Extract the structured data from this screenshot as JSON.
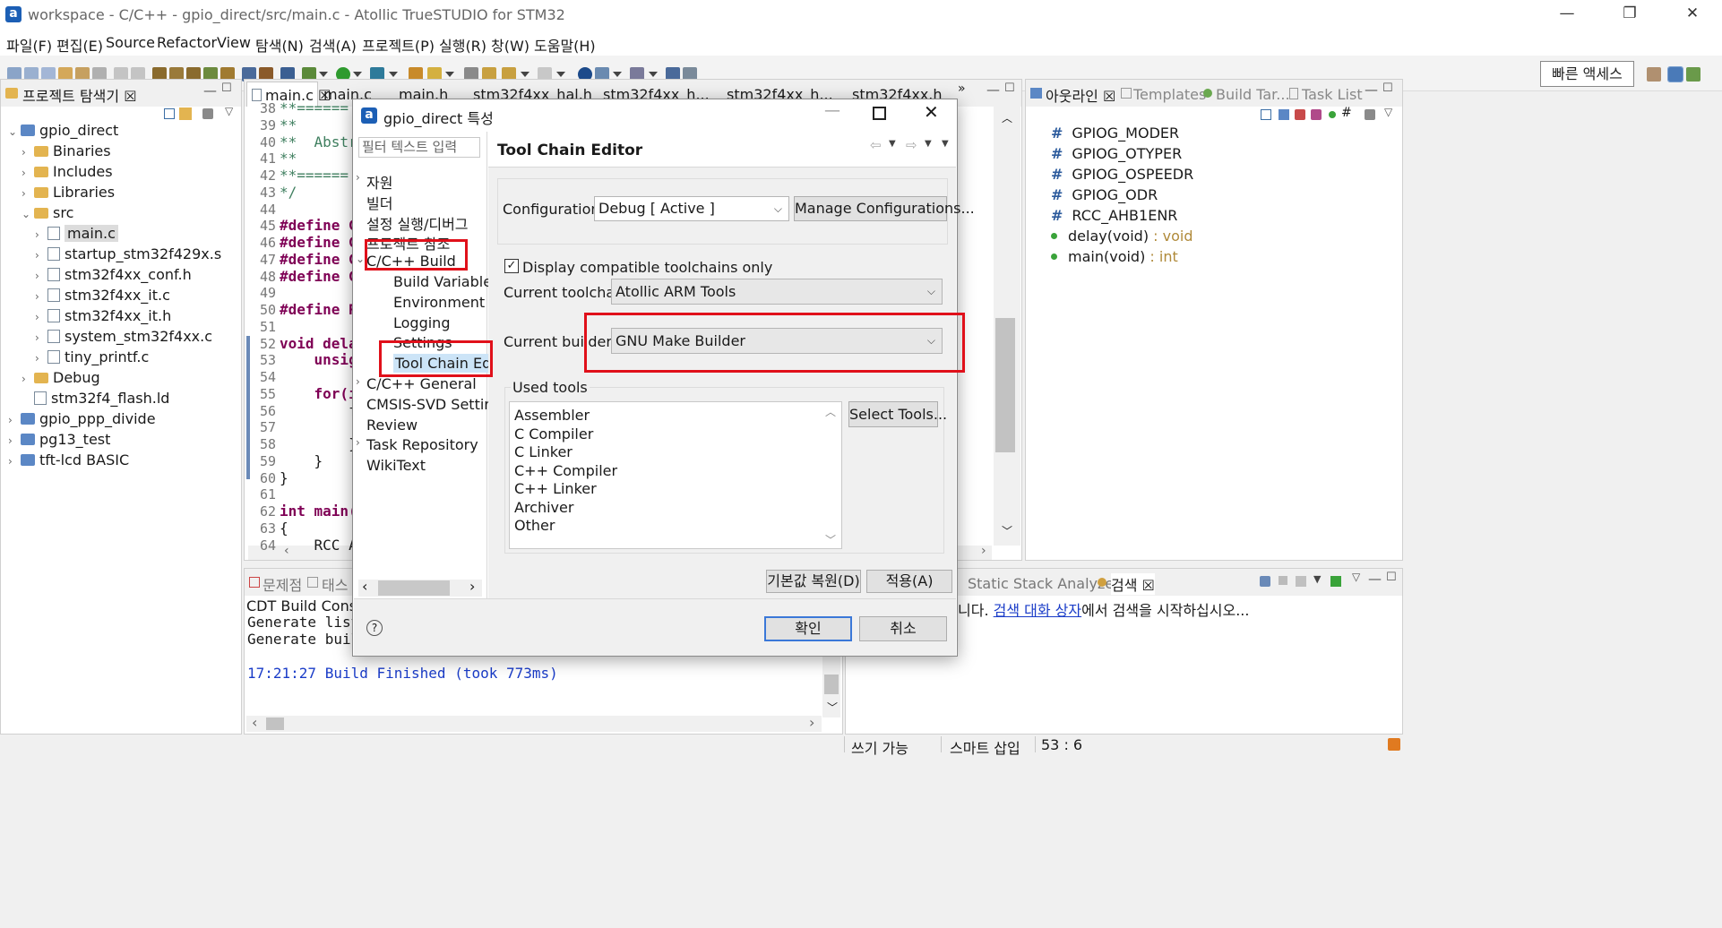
{
  "window": {
    "title": "workspace - C/C++ - gpio_direct/src/main.c - Atollic TrueSTUDIO for STM32",
    "minimize": "—",
    "restore": "❐",
    "close": "✕"
  },
  "menu": [
    "파일(F)",
    "편집(E)",
    "Source",
    "Refactor",
    "View",
    "탐색(N)",
    "검색(A)",
    "프로젝트(P)",
    "실행(R)",
    "창(W)",
    "도움말(H)"
  ],
  "toolbar": {
    "quick_access": "빠른 액세스"
  },
  "project_explorer": {
    "tab_label": "프로젝트 탐색기 ☒",
    "tree": [
      {
        "label": "gpio_direct",
        "level": 0,
        "type": "project",
        "chev": "⌄"
      },
      {
        "label": "Binaries",
        "level": 1,
        "type": "folder",
        "chev": "›"
      },
      {
        "label": "Includes",
        "level": 1,
        "type": "folder",
        "chev": "›"
      },
      {
        "label": "Libraries",
        "level": 1,
        "type": "folder",
        "chev": "›"
      },
      {
        "label": "src",
        "level": 1,
        "type": "folder",
        "chev": "⌄"
      },
      {
        "label": "main.c",
        "level": 2,
        "type": "file",
        "chev": "›",
        "selected": true
      },
      {
        "label": "startup_stm32f429x.s",
        "level": 2,
        "type": "file",
        "chev": "›"
      },
      {
        "label": "stm32f4xx_conf.h",
        "level": 2,
        "type": "file",
        "chev": "›"
      },
      {
        "label": "stm32f4xx_it.c",
        "level": 2,
        "type": "file",
        "chev": "›"
      },
      {
        "label": "stm32f4xx_it.h",
        "level": 2,
        "type": "file",
        "chev": "›"
      },
      {
        "label": "system_stm32f4xx.c",
        "level": 2,
        "type": "file",
        "chev": "›"
      },
      {
        "label": "tiny_printf.c",
        "level": 2,
        "type": "file",
        "chev": "›"
      },
      {
        "label": "Debug",
        "level": 1,
        "type": "folder",
        "chev": "›"
      },
      {
        "label": "stm32f4_flash.ld",
        "level": 1,
        "type": "file",
        "chev": ""
      },
      {
        "label": "gpio_ppp_divide",
        "level": 0,
        "type": "project",
        "chev": "›"
      },
      {
        "label": "pg13_test",
        "level": 0,
        "type": "project",
        "chev": "›"
      },
      {
        "label": "tft-lcd BASIC",
        "level": 0,
        "type": "project",
        "chev": "›"
      }
    ]
  },
  "editor": {
    "tabs": [
      "main.c ☒",
      "main.c",
      "main.h",
      "stm32f4xx_hal.h",
      "stm32f4xx_h...",
      "stm32f4xx_h...",
      "stm32f4xx.h"
    ],
    "overflow": "»",
    "lines": [
      {
        "n": "38",
        "t": "**======"
      },
      {
        "n": "39",
        "t": "**"
      },
      {
        "n": "40",
        "t": "**  Abstr"
      },
      {
        "n": "41",
        "t": "**"
      },
      {
        "n": "42",
        "t": "**======"
      },
      {
        "n": "43",
        "t": "*/"
      },
      {
        "n": "44",
        "t": ""
      },
      {
        "n": "45",
        "t": "#define G"
      },
      {
        "n": "46",
        "t": "#define G"
      },
      {
        "n": "47",
        "t": "#define G"
      },
      {
        "n": "48",
        "t": "#define G"
      },
      {
        "n": "49",
        "t": ""
      },
      {
        "n": "50",
        "t": "#define R"
      },
      {
        "n": "51",
        "t": ""
      },
      {
        "n": "52",
        "t": "void dela"
      },
      {
        "n": "53",
        "t": "    unsig"
      },
      {
        "n": "54",
        "t": ""
      },
      {
        "n": "55",
        "t": "    for(i"
      },
      {
        "n": "56",
        "t": "        f"
      },
      {
        "n": "57",
        "t": ""
      },
      {
        "n": "58",
        "t": "        }"
      },
      {
        "n": "59",
        "t": "    }"
      },
      {
        "n": "60",
        "t": "}"
      },
      {
        "n": "61",
        "t": ""
      },
      {
        "n": "62",
        "t": "int main("
      },
      {
        "n": "63",
        "t": "{"
      },
      {
        "n": "64",
        "t": "    RCC A"
      }
    ]
  },
  "outline": {
    "tabs": [
      "아웃라인 ☒",
      "Templates",
      "Build Tar...",
      "Task List"
    ],
    "items": [
      {
        "kind": "macro",
        "name": "GPIOG_MODER",
        "type": ""
      },
      {
        "kind": "macro",
        "name": "GPIOG_OTYPER",
        "type": ""
      },
      {
        "kind": "macro",
        "name": "GPIOG_OSPEEDR",
        "type": ""
      },
      {
        "kind": "macro",
        "name": "GPIOG_ODR",
        "type": ""
      },
      {
        "kind": "macro",
        "name": "RCC_AHB1ENR",
        "type": ""
      },
      {
        "kind": "func",
        "name": "delay(void)",
        "type": " : void"
      },
      {
        "kind": "func",
        "name": "main(void)",
        "type": " : int"
      }
    ]
  },
  "console": {
    "tabs": [
      "문제점",
      "태스"
    ],
    "title": "CDT Build Console",
    "lines": [
      "Generate list",
      "Generate buil"
    ],
    "finished": "17:21:27 Build Finished (took 773ms)"
  },
  "search": {
    "tabs": [
      "Static Stack Analyzer",
      "검색 ☒"
    ],
    "prefix": "니다. ",
    "link": "검색 대화 상자",
    "suffix": "에서 검색을 시작하십시오..."
  },
  "status": {
    "writable": "쓰기 가능",
    "insert_mode": "스마트 삽입",
    "position": "53 : 6"
  },
  "dialog": {
    "title": "gpio_direct 특성",
    "filter_placeholder": "필터 텍스트 입력",
    "nav": [
      {
        "label": "자원",
        "level": 0,
        "chev": "›"
      },
      {
        "label": "빌더",
        "level": 0,
        "chev": ""
      },
      {
        "label": "설정 실행/디버그",
        "level": 0,
        "chev": ""
      },
      {
        "label": "프로젝트 참조",
        "level": 0,
        "chev": ""
      },
      {
        "label": "C/C++ Build",
        "level": 0,
        "chev": "⌄"
      },
      {
        "label": "Build Variables",
        "level": 1,
        "chev": ""
      },
      {
        "label": "Environment",
        "level": 1,
        "chev": ""
      },
      {
        "label": "Logging",
        "level": 1,
        "chev": ""
      },
      {
        "label": "Settings",
        "level": 1,
        "chev": ""
      },
      {
        "label": "Tool Chain Edit",
        "level": 1,
        "chev": "",
        "selected": true
      },
      {
        "label": "C/C++ General",
        "level": 0,
        "chev": "›"
      },
      {
        "label": "CMSIS-SVD Settir",
        "level": 0,
        "chev": ""
      },
      {
        "label": "Review",
        "level": 0,
        "chev": ""
      },
      {
        "label": "Task Repository",
        "level": 0,
        "chev": "›"
      },
      {
        "label": "WikiText",
        "level": 0,
        "chev": ""
      }
    ],
    "page_title": "Tool Chain Editor",
    "configuration_label": "Configuration:",
    "configuration_value": "Debug  [ Active ]",
    "manage_configurations": "Manage Configurations...",
    "display_compatible": "Display compatible toolchains only",
    "display_compatible_checked": true,
    "current_toolchain_label": "Current toolchain:",
    "current_toolchain_value": "Atollic ARM Tools",
    "current_builder_label": "Current builder:",
    "current_builder_value": "GNU Make Builder",
    "used_tools_label": "Used tools",
    "used_tools": [
      "Assembler",
      "C Compiler",
      "C Linker",
      "C++ Compiler",
      "C++ Linker",
      "Archiver",
      "Other"
    ],
    "select_tools": "Select Tools...",
    "restore_defaults": "기본값 복원(D)",
    "apply": "적용(A)",
    "ok": "확인",
    "cancel": "취소",
    "help": "?"
  }
}
